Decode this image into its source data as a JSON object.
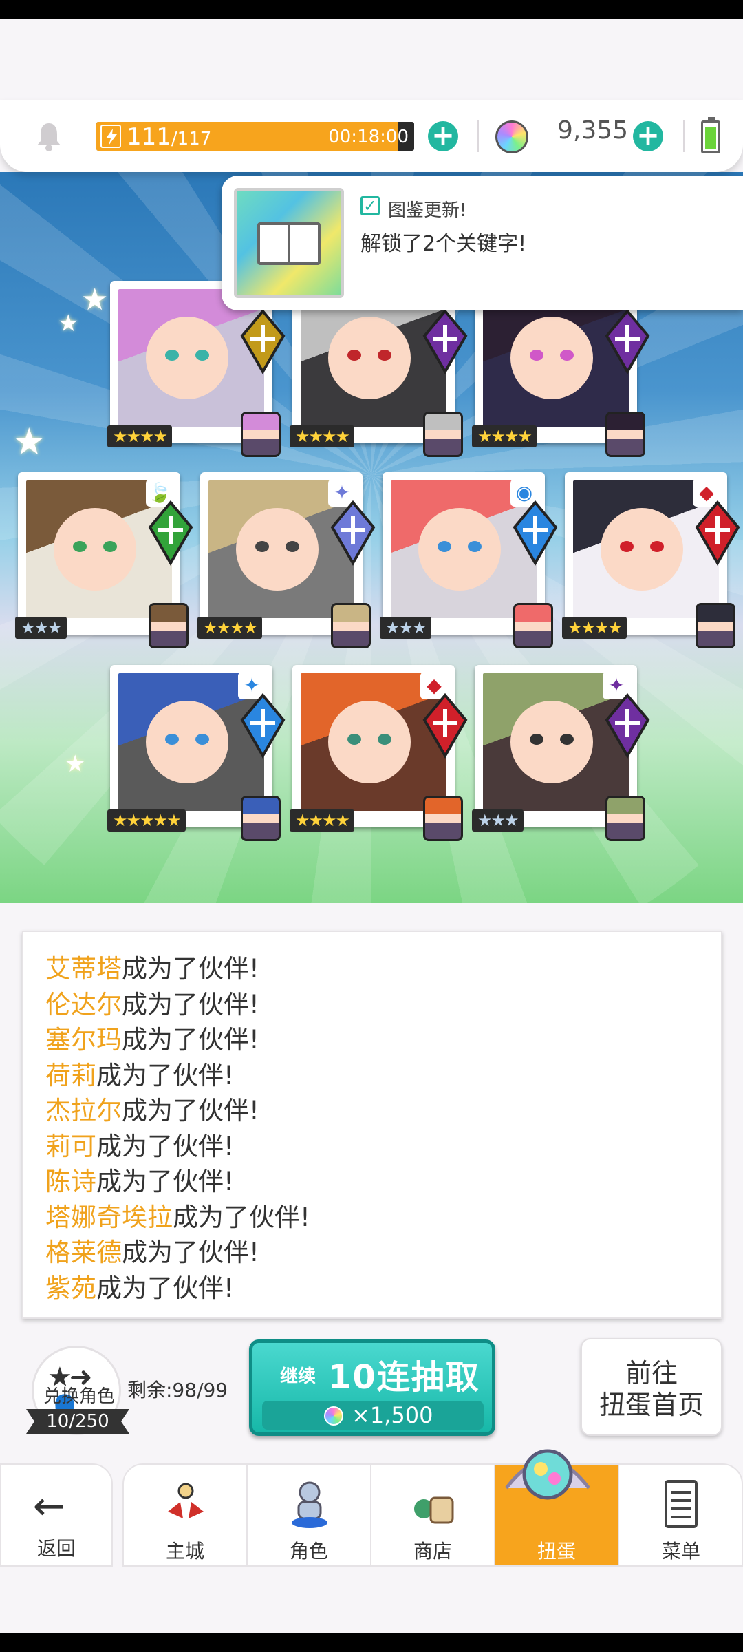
{
  "header": {
    "stamina_current": "111",
    "stamina_max": "/117",
    "stamina_fraction": 0.949,
    "stamina_timer": "00:18:00",
    "gem_count": "9,355"
  },
  "notification": {
    "title": "图鉴更新!",
    "body": "解锁了2个关键字!"
  },
  "cards": [
    {
      "stars": "★★★★",
      "rarity": 4,
      "hair": "#d38bd9",
      "eye": "#3ab3a8",
      "bg": "#c9c1d9",
      "badge": "#c29a1a",
      "row": 0,
      "col": 0
    },
    {
      "stars": "★★★★",
      "rarity": 4,
      "hair": "#bfbfbf",
      "eye": "#c0262b",
      "bg": "#3b3a3d",
      "badge": "#6f2fa0",
      "row": 0,
      "col": 1
    },
    {
      "stars": "★★★★",
      "rarity": 4,
      "hair": "#2c2033",
      "eye": "#d058c8",
      "bg": "#2f2b4a",
      "badge": "#6f2fa0",
      "row": 0,
      "col": 2
    },
    {
      "stars": "★★★",
      "rarity": 3,
      "hair": "#7a5a3a",
      "eye": "#3aa35a",
      "bg": "#e9e4d8",
      "badge": "#32a33a",
      "row": 1,
      "col": 0,
      "elem": "🍃"
    },
    {
      "stars": "★★★★",
      "rarity": 4,
      "hair": "#c9b585",
      "eye": "#444444",
      "bg": "#7a7a7a",
      "badge": "#6e7ad8",
      "row": 1,
      "col": 1,
      "elem": "✦"
    },
    {
      "stars": "★★★",
      "rarity": 3,
      "hair": "#ef6a6a",
      "eye": "#3a8fd8",
      "bg": "#d8d4dc",
      "badge": "#2a86e0",
      "row": 1,
      "col": 2,
      "elem": "◉"
    },
    {
      "stars": "★★★★",
      "rarity": 4,
      "hair": "#2d2d3a",
      "eye": "#d0202a",
      "bg": "#f1eef4",
      "badge": "#d0202a",
      "row": 1,
      "col": 3,
      "elem": "◆"
    },
    {
      "stars": "★★★★★",
      "rarity": 5,
      "hair": "#3a5fb8",
      "eye": "#3a8fd8",
      "bg": "#5a5a5a",
      "badge": "#2a86e0",
      "row": 2,
      "col": 0,
      "elem": "✦"
    },
    {
      "stars": "★★★★",
      "rarity": 4,
      "hair": "#e2652a",
      "eye": "#3a8f7a",
      "bg": "#6a3a2a",
      "badge": "#d0202a",
      "row": 2,
      "col": 1,
      "elem": "◆"
    },
    {
      "stars": "★★★",
      "rarity": 3,
      "hair": "#8fa26a",
      "eye": "#333333",
      "bg": "#4a3a3a",
      "badge": "#6f2fa0",
      "row": 2,
      "col": 2,
      "elem": "✦"
    }
  ],
  "log": {
    "suffix": "成为了伙伴!",
    "names": [
      "艾蒂塔",
      "伦达尔",
      "塞尔玛",
      "荷莉",
      "杰拉尔",
      "莉可",
      "陈诗",
      "塔娜奇埃拉",
      "格莱德",
      "紫苑"
    ]
  },
  "actions": {
    "swap_label": "兑换角色",
    "swap_count": "10/250",
    "remaining": "剩余:98/99",
    "draw_prefix": "继续",
    "draw_label": "10连抽取",
    "draw_cost": "×1,500",
    "goto_line1": "前往",
    "goto_line2": "扭蛋首页"
  },
  "nav": {
    "back": "返回",
    "tabs": [
      "主城",
      "角色",
      "商店",
      "扭蛋",
      "菜单"
    ],
    "active": "扭蛋"
  },
  "colors": {
    "accent_teal": "#22b7a0",
    "accent_orange": "#f7a41d",
    "name_orange": "#f0a21c"
  }
}
